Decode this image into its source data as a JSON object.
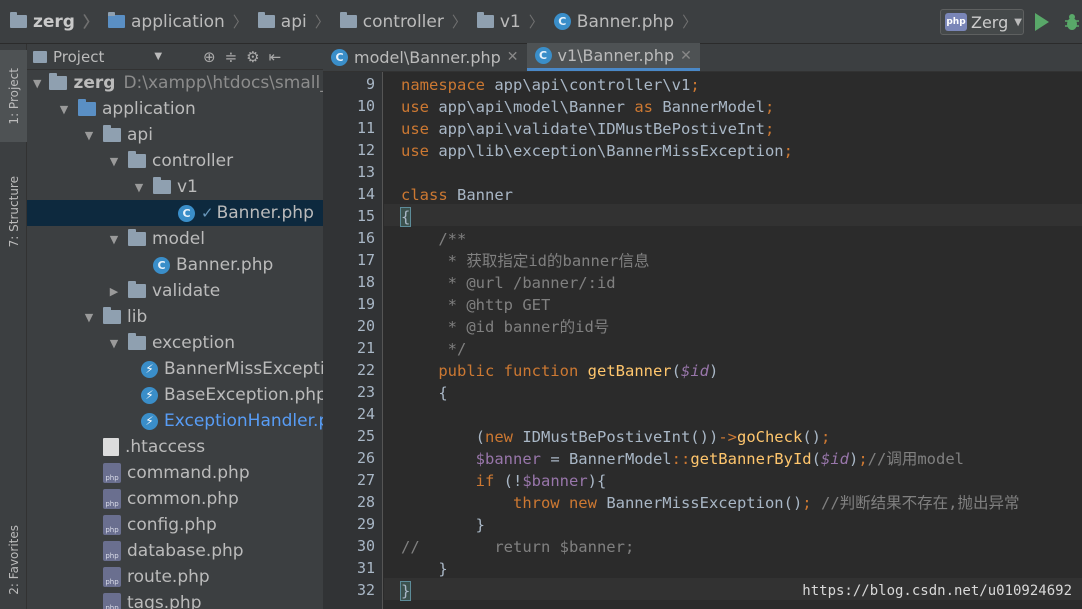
{
  "breadcrumbs": [
    "zerg",
    "application",
    "api",
    "controller",
    "v1",
    "Banner.php"
  ],
  "run_config": {
    "label": "Zerg",
    "icon_text": "php"
  },
  "left_strip": {
    "project_tab": "1: Project",
    "structure_tab": "7: Structure",
    "favorites_tab": "2: Favorites"
  },
  "project_panel": {
    "title": "Project",
    "tree": [
      {
        "label": "zerg",
        "extra": "D:\\xampp\\htdocs\\small_p",
        "icon": "folder",
        "twisty": "▼",
        "bold": true
      },
      {
        "label": "application",
        "icon": "folder-blue",
        "twisty": "▼"
      },
      {
        "label": "api",
        "icon": "folder",
        "twisty": "▼"
      },
      {
        "label": "controller",
        "icon": "folder",
        "twisty": "▼"
      },
      {
        "label": "v1",
        "icon": "folder",
        "twisty": "▼"
      },
      {
        "label": "Banner.php",
        "icon": "class",
        "selected": true
      },
      {
        "label": "model",
        "icon": "folder",
        "twisty": "▼"
      },
      {
        "label": "Banner.php",
        "icon": "class"
      },
      {
        "label": "validate",
        "icon": "folder",
        "twisty": "▶"
      },
      {
        "label": "lib",
        "icon": "folder",
        "twisty": "▼"
      },
      {
        "label": "exception",
        "icon": "folder",
        "twisty": "▼"
      },
      {
        "label": "BannerMissExcepti",
        "icon": "exception"
      },
      {
        "label": "BaseException.php",
        "icon": "exception"
      },
      {
        "label": "ExceptionHandler.p",
        "icon": "exception",
        "blue": true
      },
      {
        "label": ".htaccess",
        "icon": "htaccess"
      },
      {
        "label": "command.php",
        "icon": "php"
      },
      {
        "label": "common.php",
        "icon": "php"
      },
      {
        "label": "config.php",
        "icon": "php"
      },
      {
        "label": "database.php",
        "icon": "php"
      },
      {
        "label": "route.php",
        "icon": "php"
      },
      {
        "label": "tags.php",
        "icon": "php"
      }
    ]
  },
  "editor": {
    "tabs": [
      {
        "label": "model\\Banner.php",
        "active": false
      },
      {
        "label": "v1\\Banner.php",
        "active": true
      }
    ],
    "line_numbers": [
      "9",
      "10",
      "11",
      "12",
      "13",
      "14",
      "15",
      "16",
      "17",
      "18",
      "19",
      "20",
      "21",
      "22",
      "23",
      "24",
      "25",
      "26",
      "27",
      "28",
      "29",
      "30",
      "31",
      "32"
    ]
  },
  "watermark": "https://blog.csdn.net/u010924692",
  "colors": {
    "keyword": "#cc7832",
    "function": "#ffc66d",
    "variable": "#9876aa",
    "comment": "#808080",
    "text": "#a9b7c6",
    "selection": "#0d293e"
  }
}
